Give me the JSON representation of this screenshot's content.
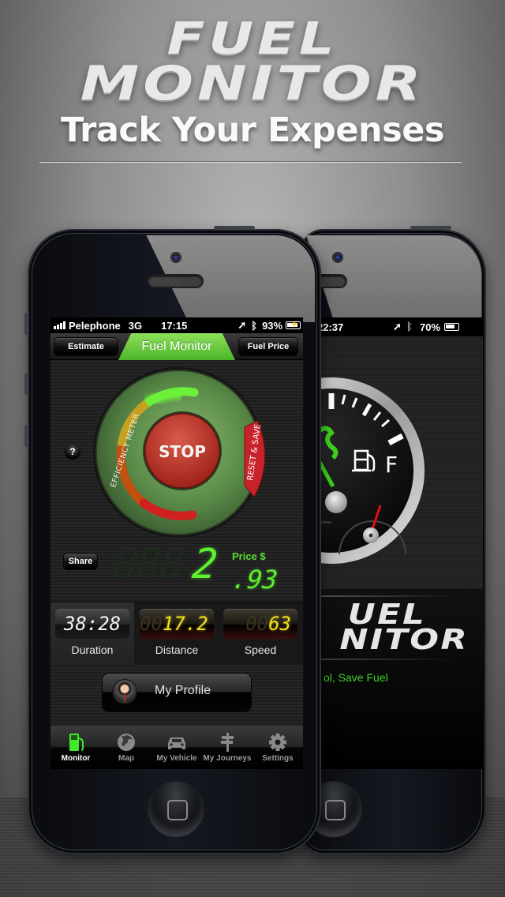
{
  "header": {
    "brand_line1": "FUEL",
    "brand_line2": "MONITOR",
    "tagline": "Track Your Expenses"
  },
  "front_phone": {
    "status_bar": {
      "carrier": "Pelephone",
      "network": "3G",
      "time": "17:15",
      "battery": "93%",
      "icons": [
        "signal-icon",
        "location-arrow-icon",
        "bluetooth-icon",
        "battery-charging-icon"
      ]
    },
    "nav_bar": {
      "left_button": "Estimate",
      "title": "Fuel Monitor",
      "right_button": "Fuel Price",
      "accent_color": "#6fcf3f"
    },
    "dial": {
      "meter_label": "EFFICIENCY METER",
      "center_button": "STOP",
      "side_button": "RESET & SAVE",
      "help_button": "?",
      "meter_colors": {
        "good": "#6cf03a",
        "medium": "#c6a020",
        "bad": "#d02020"
      }
    },
    "price": {
      "share_button": "Share",
      "label": "Price $",
      "ghost_digits": "888",
      "whole": "2",
      "fraction": ".93"
    },
    "stats": [
      {
        "label": "Duration",
        "ghost": "",
        "value": "38:28",
        "active": true
      },
      {
        "label": "Distance",
        "ghost": "00",
        "value": "17.2",
        "active": false
      },
      {
        "label": "Speed",
        "ghost": "00",
        "value": "63",
        "active": false
      }
    ],
    "profile_button": "My Profile",
    "tabs": [
      {
        "label": "Monitor",
        "icon": "fuel-pump-icon",
        "active": true
      },
      {
        "label": "Map",
        "icon": "globe-icon",
        "active": false
      },
      {
        "label": "My Vehicle",
        "icon": "car-icon",
        "active": false
      },
      {
        "label": "My Journeys",
        "icon": "signpost-icon",
        "active": false
      },
      {
        "label": "Settings",
        "icon": "gear-icon",
        "active": false
      }
    ]
  },
  "back_phone": {
    "status_bar": {
      "time": "22:37",
      "battery": "70%"
    },
    "gauge": {
      "full_label": "F"
    },
    "logo_line1": "UEL",
    "logo_line2": "NITOR",
    "tagline_fragment": "ol, Save Fuel"
  }
}
